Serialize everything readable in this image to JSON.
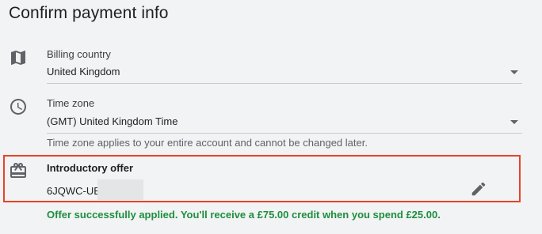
{
  "page": {
    "title": "Confirm payment info"
  },
  "billing_country": {
    "label": "Billing country",
    "value": "United Kingdom",
    "icon": "map-icon"
  },
  "time_zone": {
    "label": "Time zone",
    "value": "(GMT) United Kingdom Time",
    "helper": "Time zone applies to your entire account and cannot be changed later.",
    "icon": "clock-icon"
  },
  "offer": {
    "title": "Introductory offer",
    "code": "6JQWC-UE(",
    "icon": "gift-card-icon",
    "edit_icon": "pencil-icon",
    "success_message": "Offer successfully applied. You'll receive a £75.00 credit when you spend £25.00."
  },
  "colors": {
    "background": "#f1f3f4",
    "highlight_border": "#e8432a",
    "success": "#1e8e3e",
    "icon": "#5f6368"
  }
}
